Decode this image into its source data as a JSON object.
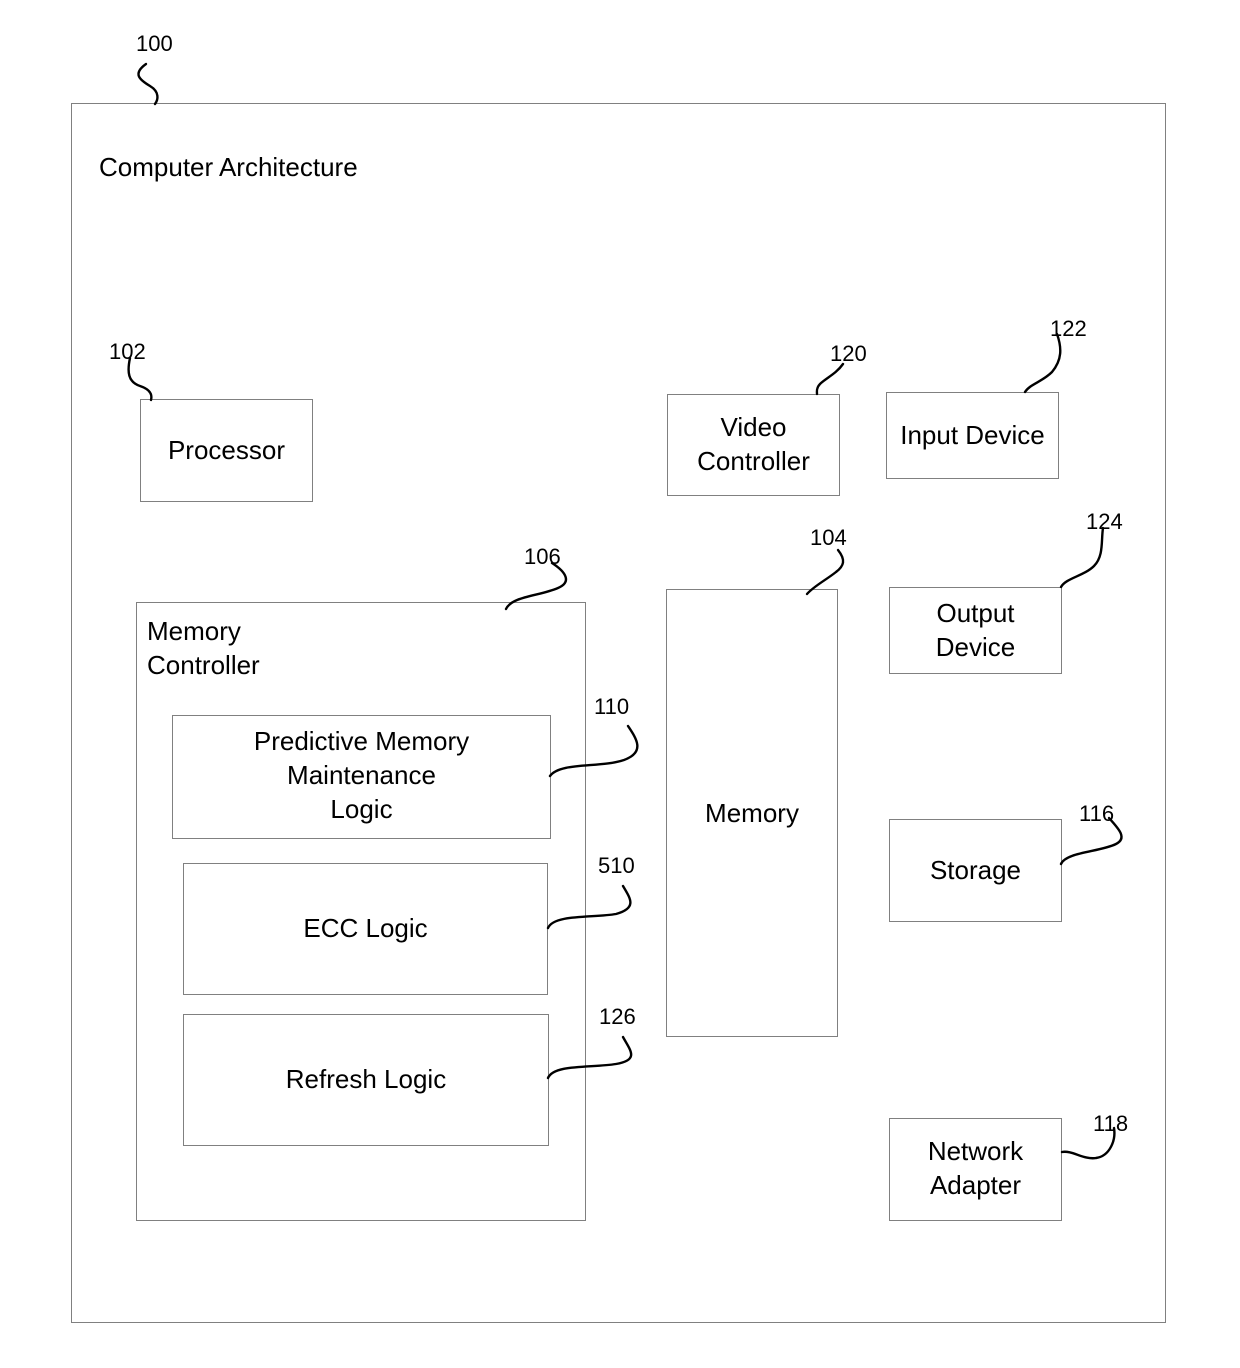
{
  "figure": {
    "ref": "100",
    "title": "Computer Architecture"
  },
  "components": {
    "processor": {
      "ref": "102",
      "label": "Processor"
    },
    "memory_controller": {
      "ref": "106",
      "label": "Memory\nController"
    },
    "predictive_logic": {
      "ref": "110",
      "label": "Predictive Memory\nMaintenance\nLogic"
    },
    "ecc_logic": {
      "ref": "510",
      "label": "ECC Logic"
    },
    "refresh_logic": {
      "ref": "126",
      "label": "Refresh Logic"
    },
    "memory": {
      "ref": "104",
      "label": "Memory"
    },
    "video_controller": {
      "ref": "120",
      "label": "Video\nController"
    },
    "input_device": {
      "ref": "122",
      "label": "Input Device"
    },
    "output_device": {
      "ref": "124",
      "label": "Output\nDevice"
    },
    "storage": {
      "ref": "116",
      "label": "Storage"
    },
    "network_adapter": {
      "ref": "118",
      "label": "Network\nAdapter"
    }
  }
}
